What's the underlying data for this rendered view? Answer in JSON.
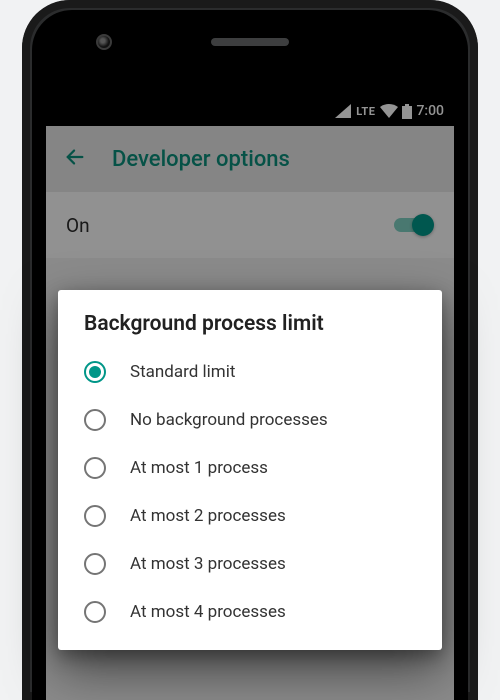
{
  "statusbar": {
    "network_label": "LTE",
    "clock": "7:00"
  },
  "appbar": {
    "title": "Developer options"
  },
  "master_toggle": {
    "label": "On",
    "enabled": true
  },
  "dialog": {
    "title": "Background process limit",
    "selected_index": 0,
    "options": [
      {
        "label": "Standard limit"
      },
      {
        "label": "No background processes"
      },
      {
        "label": "At most 1 process"
      },
      {
        "label": "At most 2 processes"
      },
      {
        "label": "At most 3 processes"
      },
      {
        "label": "At most 4 processes"
      }
    ]
  },
  "colors": {
    "accent": "#009688",
    "appbar_text": "#0b8e7a"
  }
}
